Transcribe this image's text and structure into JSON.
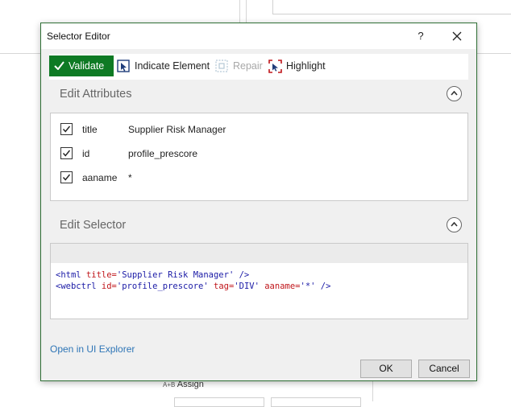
{
  "dialog": {
    "title": "Selector Editor",
    "help_label": "?"
  },
  "toolbar": {
    "validate_label": "Validate",
    "indicate_label": "Indicate Element",
    "repair_label": "Repair",
    "highlight_label": "Highlight",
    "validate_color": "#0e7a24"
  },
  "edit_attributes": {
    "heading": "Edit Attributes",
    "rows": [
      {
        "checked": true,
        "name": "title",
        "value": "Supplier Risk Manager"
      },
      {
        "checked": true,
        "name": "id",
        "value": "profile_prescore"
      },
      {
        "checked": true,
        "name": "aaname",
        "value": "*"
      }
    ]
  },
  "edit_selector": {
    "heading": "Edit Selector",
    "lines": [
      [
        {
          "t": "<html ",
          "k": "tag"
        },
        {
          "t": "title=",
          "k": "attr"
        },
        {
          "t": "'Supplier Risk Manager'",
          "k": "val"
        },
        {
          "t": " />",
          "k": "tag"
        }
      ],
      [
        {
          "t": "<webctrl ",
          "k": "tag"
        },
        {
          "t": "id=",
          "k": "attr"
        },
        {
          "t": "'profile_prescore'",
          "k": "val"
        },
        {
          "t": " ",
          "k": "plain"
        },
        {
          "t": "tag=",
          "k": "attr"
        },
        {
          "t": "'DIV'",
          "k": "val"
        },
        {
          "t": " ",
          "k": "plain"
        },
        {
          "t": "aaname=",
          "k": "attr"
        },
        {
          "t": "'*'",
          "k": "val"
        },
        {
          "t": " />",
          "k": "tag"
        }
      ]
    ]
  },
  "footer": {
    "link_label": "Open in UI Explorer",
    "ok_label": "OK",
    "cancel_label": "Cancel"
  },
  "background": {
    "assign_label": "Assign",
    "assign_icon_text": "A+B"
  }
}
